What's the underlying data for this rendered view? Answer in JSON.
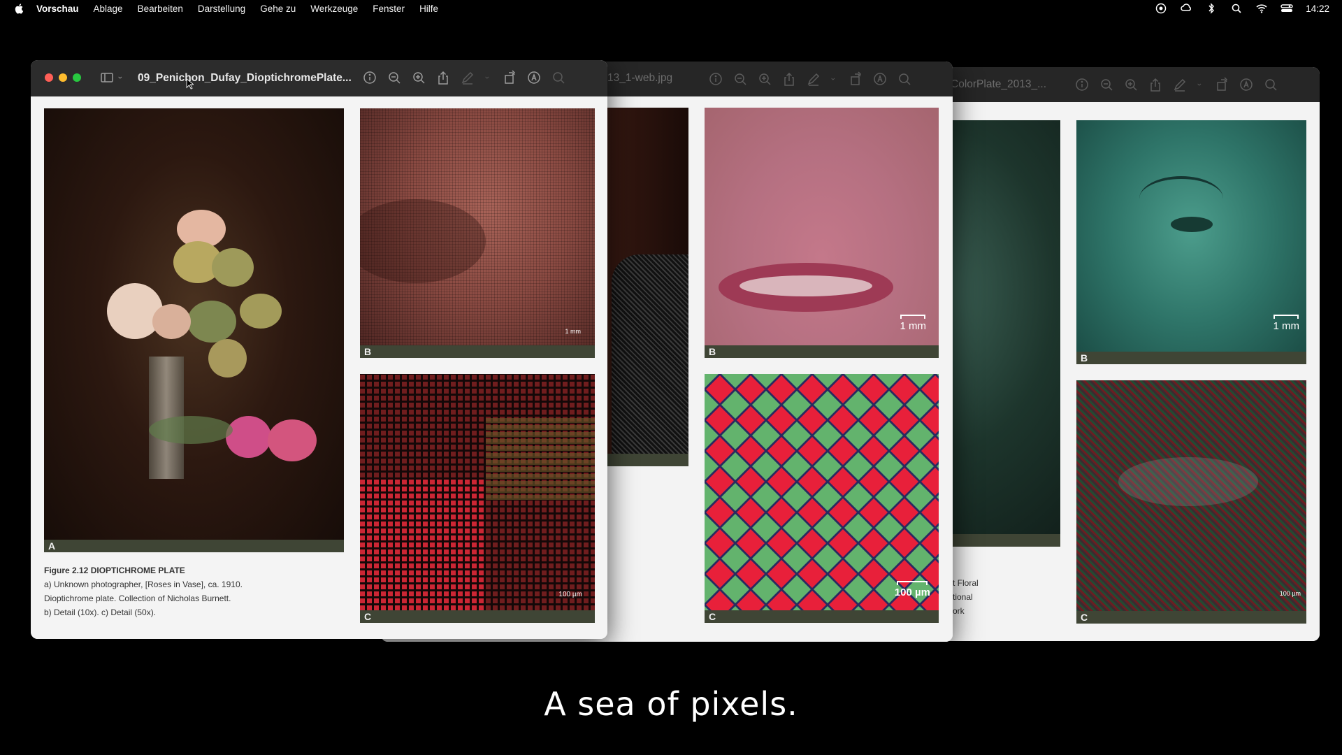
{
  "menubar": {
    "app_name": "Vorschau",
    "items": [
      "Ablage",
      "Bearbeiten",
      "Darstellung",
      "Gehe zu",
      "Werkzeuge",
      "Fenster",
      "Hilfe"
    ],
    "time": "14:22"
  },
  "windows": {
    "front": {
      "title": "09_Penichon_Dufay_DioptichromePlate...",
      "labels": {
        "a": "A",
        "b": "B",
        "c": "C"
      },
      "scale_b": "1 mm",
      "scale_c": "100 µm",
      "figure_caption": {
        "heading": "Figure 2.12  DIOPTICHROME PLATE",
        "lines": [
          "a) Unknown photographer, [Roses in Vase], ca. 1910.",
          "Dioptichrome plate. Collection of Nicholas Burnett.",
          "b) Detail (10x). c) Detail (50x)."
        ]
      }
    },
    "middle": {
      "title": "13_1-web.jpg",
      "labels": {
        "b": "B",
        "c": "C"
      },
      "scale_b": "1 mm",
      "scale_c": "100 µm"
    },
    "back": {
      "title": "ColorPlate_2013_...",
      "labels": {
        "b": "B",
        "c": "C"
      },
      "scale_b": "1 mm",
      "scale_c": "100 µm",
      "caption_fragments": [
        "t Floral",
        "tional",
        "ork"
      ]
    }
  },
  "subtitle": "A sea of pixels.",
  "colors": {
    "close": "#ff5f57",
    "minimize": "#febc2e",
    "zoom": "#28c840",
    "plate_label_bg": "#3f4535"
  }
}
